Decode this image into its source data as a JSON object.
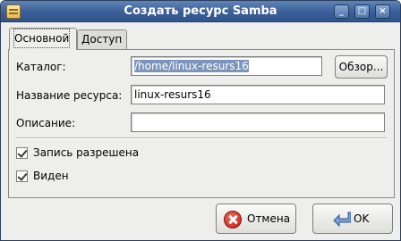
{
  "window": {
    "title": "Создать ресурс Samba",
    "controls": {
      "minimize": "_",
      "maximize": "□",
      "close": "×"
    }
  },
  "tabs": [
    {
      "label": "Основной",
      "active": true
    },
    {
      "label": "Доступ",
      "active": false
    }
  ],
  "form": {
    "directory": {
      "label": "Каталог:",
      "value": "/home/linux-resurs16",
      "browse_label": "Обзор..."
    },
    "share_name": {
      "label": "Название ресурса:",
      "value": "linux-resurs16"
    },
    "description": {
      "label": "Описание:",
      "value": ""
    },
    "write_allowed": {
      "label": "Запись разрешена",
      "checked": true
    },
    "visible": {
      "label": "Виден",
      "checked": true
    }
  },
  "buttons": {
    "cancel": {
      "label": "Отмена",
      "icon": "cancel-icon"
    },
    "ok": {
      "label": "OK",
      "icon": "ok-arrow-icon"
    }
  },
  "colors": {
    "titlebar": "#3a5f98",
    "selection": "#7c95bc",
    "window_bg": "#eeeeec"
  }
}
